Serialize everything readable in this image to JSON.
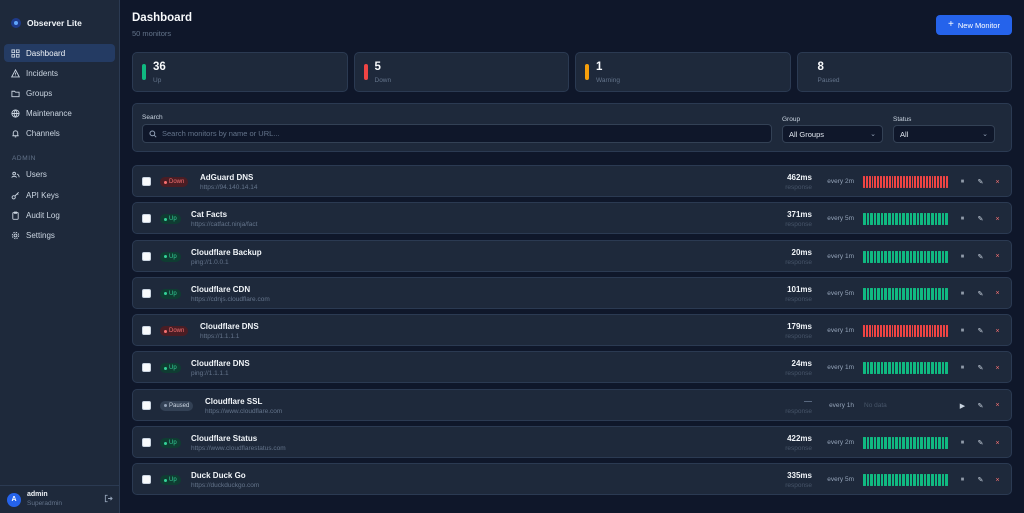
{
  "app": {
    "name": "Observer Lite"
  },
  "sidebar": {
    "items": [
      {
        "label": "Dashboard",
        "icon": "dashboard-icon",
        "active": true
      },
      {
        "label": "Incidents",
        "icon": "warning-icon"
      },
      {
        "label": "Groups",
        "icon": "folder-icon"
      },
      {
        "label": "Maintenance",
        "icon": "globe-icon"
      },
      {
        "label": "Channels",
        "icon": "bell-icon"
      }
    ],
    "admin_label": "ADMIN",
    "admin_items": [
      {
        "label": "Users",
        "icon": "users-icon"
      },
      {
        "label": "API Keys",
        "icon": "key-icon"
      },
      {
        "label": "Audit Log",
        "icon": "clipboard-icon"
      },
      {
        "label": "Settings",
        "icon": "gear-icon"
      }
    ],
    "user": {
      "initial": "A",
      "name": "admin",
      "role": "Superadmin"
    }
  },
  "header": {
    "title": "Dashboard",
    "subtitle": "50 monitors",
    "new_button": "New Monitor"
  },
  "stats": [
    {
      "value": "36",
      "label": "Up",
      "color": "#10b981"
    },
    {
      "value": "5",
      "label": "Down",
      "color": "#ef4444"
    },
    {
      "value": "1",
      "label": "Warning",
      "color": "#f59e0b"
    },
    {
      "value": "8",
      "label": "Paused",
      "color": ""
    }
  ],
  "filters": {
    "search_label": "Search",
    "search_placeholder": "Search monitors by name or URL...",
    "group_label": "Group",
    "group_value": "All Groups",
    "status_label": "Status",
    "status_value": "All"
  },
  "colors": {
    "up": "#10b981",
    "down": "#ef4444",
    "paused": "#94a3b8"
  },
  "monitors": [
    {
      "status": "down",
      "status_label": "Down",
      "name": "AdGuard DNS",
      "url": "https://94.140.14.14",
      "response": "462ms",
      "response_label": "response",
      "interval": "every 2m",
      "heartbeat": "down"
    },
    {
      "status": "up",
      "status_label": "Up",
      "name": "Cat Facts",
      "url": "https://catfact.ninja/fact",
      "response": "371ms",
      "response_label": "response",
      "interval": "every 5m",
      "heartbeat": "up"
    },
    {
      "status": "up",
      "status_label": "Up",
      "name": "Cloudflare Backup",
      "url": "ping://1.0.0.1",
      "response": "20ms",
      "response_label": "response",
      "interval": "every 1m",
      "heartbeat": "up"
    },
    {
      "status": "up",
      "status_label": "Up",
      "name": "Cloudflare CDN",
      "url": "https://cdnjs.cloudflare.com",
      "response": "101ms",
      "response_label": "response",
      "interval": "every 5m",
      "heartbeat": "up"
    },
    {
      "status": "down",
      "status_label": "Down",
      "name": "Cloudflare DNS",
      "url": "https://1.1.1.1",
      "response": "179ms",
      "response_label": "response",
      "interval": "every 1m",
      "heartbeat": "down"
    },
    {
      "status": "up",
      "status_label": "Up",
      "name": "Cloudflare DNS",
      "url": "ping://1.1.1.1",
      "response": "24ms",
      "response_label": "response",
      "interval": "every 1m",
      "heartbeat": "up"
    },
    {
      "status": "paused",
      "status_label": "Paused",
      "name": "Cloudflare SSL",
      "url": "https://www.cloudflare.com",
      "response": "—",
      "response_label": "response",
      "interval": "every 1h",
      "heartbeat": "none",
      "no_data": "No data"
    },
    {
      "status": "up",
      "status_label": "Up",
      "name": "Cloudflare Status",
      "url": "https://www.cloudflarestatus.com",
      "response": "422ms",
      "response_label": "response",
      "interval": "every 2m",
      "heartbeat": "up"
    },
    {
      "status": "up",
      "status_label": "Up",
      "name": "Duck Duck Go",
      "url": "https://duckduckgo.com",
      "response": "335ms",
      "response_label": "response",
      "interval": "every 5m",
      "heartbeat": "up"
    }
  ]
}
